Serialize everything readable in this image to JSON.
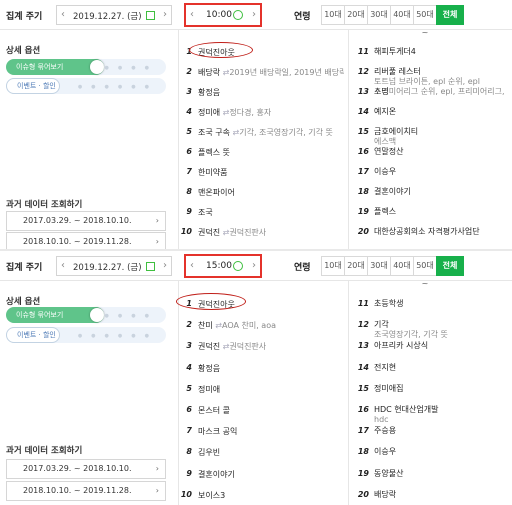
{
  "panels": [
    {
      "period_label": "집계 주기",
      "date": "2019.12.27. (금)",
      "time": "10:00",
      "age_label": "연령",
      "ages": [
        "10대",
        "20대",
        "30대",
        "40대",
        "50대 ~",
        "전체"
      ],
      "options_title": "상세 옵션",
      "toggle_issue": "이슈형 묶어보기",
      "toggle_event": "이벤트 · 할인",
      "history_title": "과거 데이터 조회하기",
      "history": [
        "2017.03.29. ~ 2018.10.10.",
        "2018.10.10. ~ 2019.11.28."
      ],
      "ranks_left": [
        {
          "num": "1",
          "name": "권덕진아웃",
          "sub": ""
        },
        {
          "num": "2",
          "name": "배당락",
          "sub": "2019년 배당락일, 2019년 배당락, 배당기준일"
        },
        {
          "num": "3",
          "name": "황정음",
          "sub": ""
        },
        {
          "num": "4",
          "name": "정미애",
          "sub": "정다경, 홍자"
        },
        {
          "num": "5",
          "name": "조국 구속",
          "sub": "기각, 조국영장기각, 기각 뜻"
        },
        {
          "num": "6",
          "name": "플렉스 뜻",
          "sub": ""
        },
        {
          "num": "7",
          "name": "한미약품",
          "sub": ""
        },
        {
          "num": "8",
          "name": "맨온파이어",
          "sub": ""
        },
        {
          "num": "9",
          "name": "조국",
          "sub": ""
        },
        {
          "num": "10",
          "name": "권덕진",
          "sub": "권덕진판사"
        }
      ],
      "ranks_right": [
        {
          "num": "11",
          "lines": [
            "해피투게더4"
          ]
        },
        {
          "num": "12",
          "lines": [
            "리버풀 레스터",
            "토트넘 브라이튼, epl 순위, epl",
            "프리미어리그 순위, epl, 프리미어리그, 맨유"
          ]
        },
        {
          "num": "13",
          "lines": [
            "소명"
          ]
        },
        {
          "num": "14",
          "lines": [
            "예지온"
          ]
        },
        {
          "num": "15",
          "lines": [
            "금호에이치티",
            "에스맥"
          ]
        },
        {
          "num": "16",
          "lines": [
            "연말정산"
          ]
        },
        {
          "num": "17",
          "lines": [
            "이승우"
          ]
        },
        {
          "num": "18",
          "lines": [
            "결혼이야기"
          ]
        },
        {
          "num": "19",
          "lines": [
            "플렉스"
          ]
        },
        {
          "num": "20",
          "lines": [
            "대한상공회의소 자격평가사업단"
          ]
        }
      ]
    },
    {
      "period_label": "집계 주기",
      "date": "2019.12.27. (금)",
      "time": "15:00",
      "age_label": "연령",
      "ages": [
        "10대",
        "20대",
        "30대",
        "40대",
        "50대 ~",
        "전체"
      ],
      "options_title": "상세 옵션",
      "toggle_issue": "이슈형 묶어보기",
      "toggle_event": "이벤트 · 할인",
      "history_title": "과거 데이터 조회하기",
      "history": [
        "2017.03.29. ~ 2018.10.10.",
        "2018.10.10. ~ 2019.11.28."
      ],
      "ranks_left": [
        {
          "num": "1",
          "name": "권덕진아웃",
          "sub": ""
        },
        {
          "num": "2",
          "name": "찬미",
          "sub": "AOA 찬미, aoa"
        },
        {
          "num": "3",
          "name": "권덕진",
          "sub": "권덕진판사"
        },
        {
          "num": "4",
          "name": "황정음",
          "sub": ""
        },
        {
          "num": "5",
          "name": "정미애",
          "sub": ""
        },
        {
          "num": "6",
          "name": "몬스터 콜",
          "sub": ""
        },
        {
          "num": "7",
          "name": "마스크 공익",
          "sub": ""
        },
        {
          "num": "8",
          "name": "김우빈",
          "sub": ""
        },
        {
          "num": "9",
          "name": "결혼이야기",
          "sub": ""
        },
        {
          "num": "10",
          "name": "보이스3",
          "sub": ""
        }
      ],
      "ranks_right": [
        {
          "num": "11",
          "lines": [
            "초등학생"
          ]
        },
        {
          "num": "12",
          "lines": [
            "기각",
            "조국영장기각, 기각 뜻"
          ]
        },
        {
          "num": "13",
          "lines": [
            "아프리카 시상식"
          ]
        },
        {
          "num": "14",
          "lines": [
            "전지현"
          ]
        },
        {
          "num": "15",
          "lines": [
            "정미애집"
          ]
        },
        {
          "num": "16",
          "lines": [
            "HDC 현대산업개발",
            "hdc"
          ]
        },
        {
          "num": "17",
          "lines": [
            "주승용"
          ]
        },
        {
          "num": "18",
          "lines": [
            "이승우"
          ]
        },
        {
          "num": "19",
          "lines": [
            "동양물산"
          ]
        },
        {
          "num": "20",
          "lines": [
            "배당락"
          ]
        }
      ]
    }
  ]
}
